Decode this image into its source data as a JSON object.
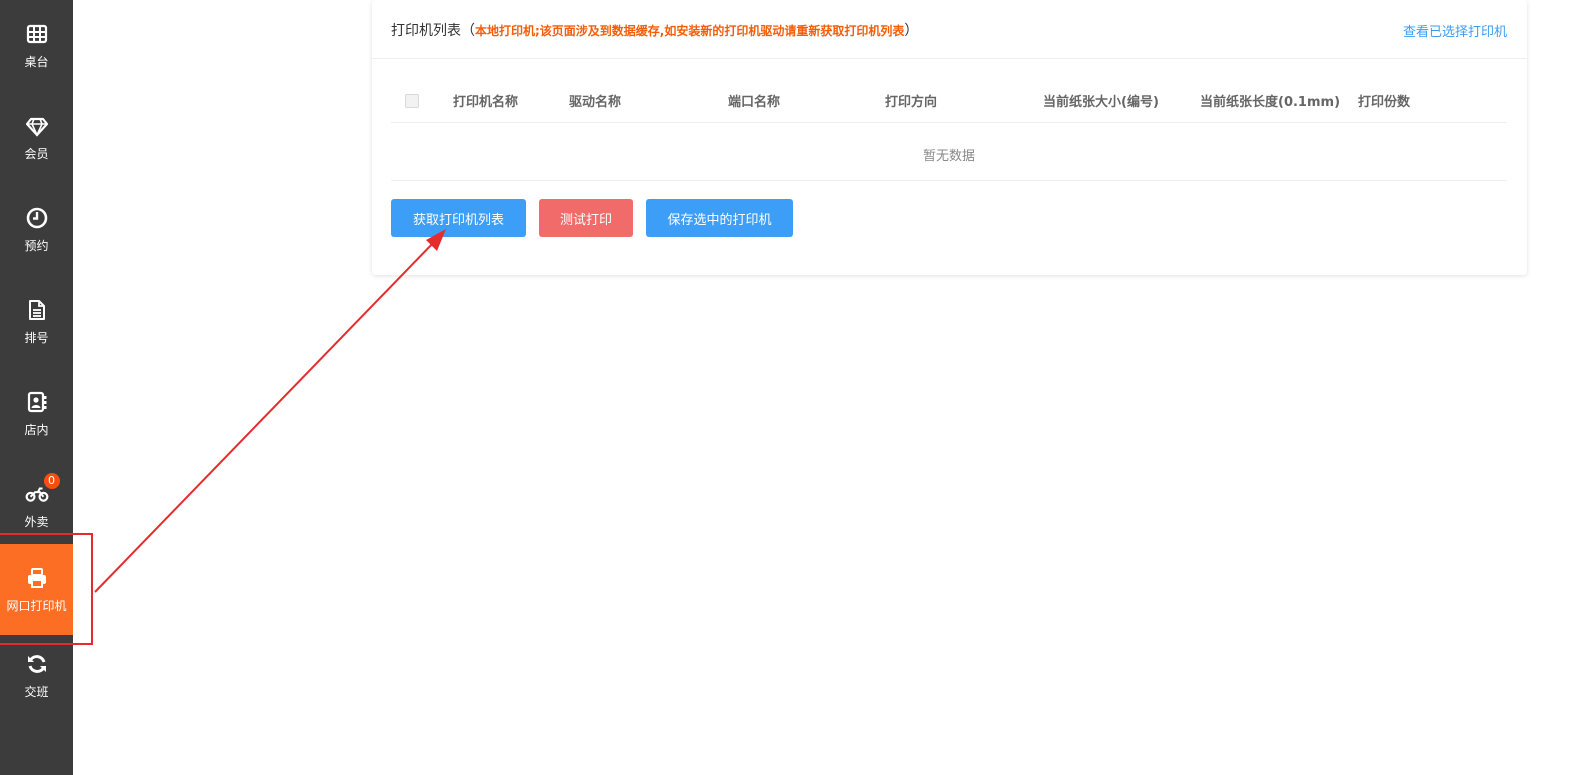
{
  "sidebar": {
    "items": [
      {
        "label": "桌台",
        "icon": "table-grid-icon"
      },
      {
        "label": "会员",
        "icon": "diamond-icon"
      },
      {
        "label": "预约",
        "icon": "clock-icon"
      },
      {
        "label": "排号",
        "icon": "document-icon"
      },
      {
        "label": "店内",
        "icon": "contact-book-icon"
      },
      {
        "label": "外卖",
        "icon": "motorcycle-icon",
        "badge": "0"
      },
      {
        "label": "网口打印机",
        "icon": "printer-icon",
        "active": true
      },
      {
        "label": "交班",
        "icon": "refresh-icon"
      }
    ]
  },
  "card": {
    "title": "打印机列表",
    "paren_open": "（",
    "warning": "本地打印机;该页面涉及到数据缓存,如安装新的打印机驱动请重新获取打印机列表",
    "paren_close": "）",
    "view_link": "查看已选择打印机"
  },
  "table": {
    "columns": [
      "打印机名称",
      "驱动名称",
      "端口名称",
      "打印方向",
      "当前纸张大小(编号)",
      "当前纸张长度(0.1mm)",
      "打印份数"
    ],
    "empty_text": "暂无数据",
    "rows": []
  },
  "buttons": {
    "fetch": "获取打印机列表",
    "test": "测试打印",
    "save": "保存选中的打印机"
  },
  "colors": {
    "sidebar_bg": "#3c3c3c",
    "active": "#fb6e23",
    "primary": "#3d9ef8",
    "danger": "#f16b6b",
    "warning_text": "#f55d07",
    "annotation": "#e52b2b"
  }
}
